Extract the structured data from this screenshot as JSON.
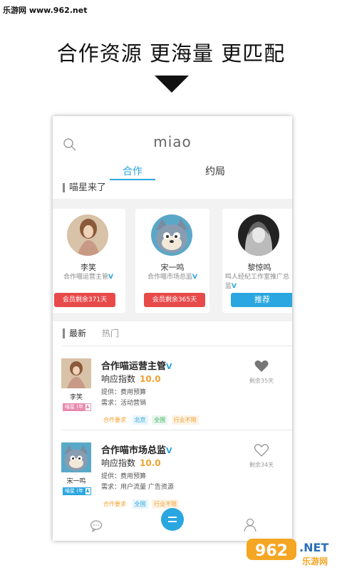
{
  "watermark_top": "乐游网 www.962.net",
  "headline": "合作资源  更海量  更匹配",
  "app": {
    "logo": "miao",
    "tabs": [
      "合作",
      "约局"
    ],
    "section_title": "喵星来了",
    "stars": [
      {
        "name": "李笑",
        "role": "合作喵运营主管",
        "verified": "V",
        "button": "会员剩余371天",
        "button_style": "red"
      },
      {
        "name": "宋一鸣",
        "role": "合作喵市场总监",
        "verified": "V",
        "button": "会员剩余365天",
        "button_style": "red"
      },
      {
        "name": "黎惊鸣",
        "role": "鸣人经纪工作室推广总监",
        "verified": "V",
        "button": "推荐",
        "button_style": "blue"
      }
    ],
    "list_tabs": {
      "latest": "最新",
      "hot": "热门"
    },
    "items": [
      {
        "name": "李笑",
        "title": "合作喵运营主管",
        "verified": "V",
        "index_label": "响应指数",
        "index_value": "10.0",
        "provide": "提供：费用预算",
        "need": "需求：活动营销",
        "badge": "喵星 (年",
        "badge_color": "#e889ad",
        "tags": {
          "req": "合作要求",
          "t1": "北京",
          "t2": "全国",
          "t3": "行业不限"
        },
        "remain": "剩余35天"
      },
      {
        "name": "宋一鸣",
        "title": "合作喵市场总监",
        "verified": "V",
        "index_label": "响应指数",
        "index_value": "10.0",
        "provide": "提供：费用预算",
        "need": "需求：用户流量  广告资源",
        "badge": "喵星 (年",
        "badge_color": "#2aa6e0",
        "tags": {
          "req": "合作要求",
          "t1": "全国",
          "t2": "行业不限"
        },
        "remain": "剩余34天"
      }
    ]
  },
  "watermark_bottom": {
    "number": "962",
    "suffix": ".NET",
    "sub": "乐游网"
  },
  "colors": {
    "accent": "#2aa6e0",
    "red": "#e84a4a",
    "orange": "#f0a030"
  }
}
